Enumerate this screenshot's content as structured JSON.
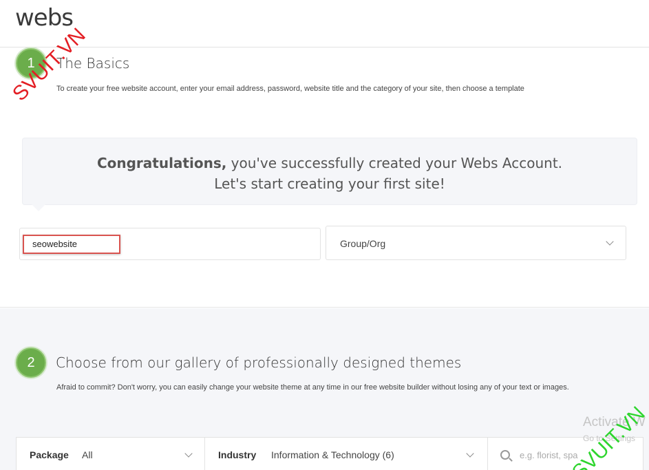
{
  "header": {
    "logo": "webs"
  },
  "step1": {
    "number": "1",
    "title": "The Basics",
    "description": "To create your free website account, enter your email address, password, website title and the category of your site, then choose a template"
  },
  "congrats": {
    "bold": "Congratulations,",
    "rest": " you've successfully created your Webs Account.",
    "line2": "Let's start creating your first site!"
  },
  "site_form": {
    "title_value": "seowebsite",
    "category_value": "Group/Org"
  },
  "step2": {
    "number": "2",
    "title": "Choose from our gallery of professionally designed themes",
    "description": "Afraid to commit? Don't worry, you can easily change your website theme at any time in our free website builder without losing any of your text or images."
  },
  "filters": {
    "package_label": "Package",
    "package_value": "All",
    "industry_label": "Industry",
    "industry_value": "Information & Technology (6)",
    "search_placeholder": "e.g. florist, spa"
  },
  "watermarks": {
    "red": "SVUIT.VN",
    "green": "SVUIT.VN",
    "activate": "Activate W",
    "activate_sub": "Go to Settings"
  },
  "colors": {
    "step_green": "#6bad4b",
    "highlight_red": "#d9534f"
  }
}
